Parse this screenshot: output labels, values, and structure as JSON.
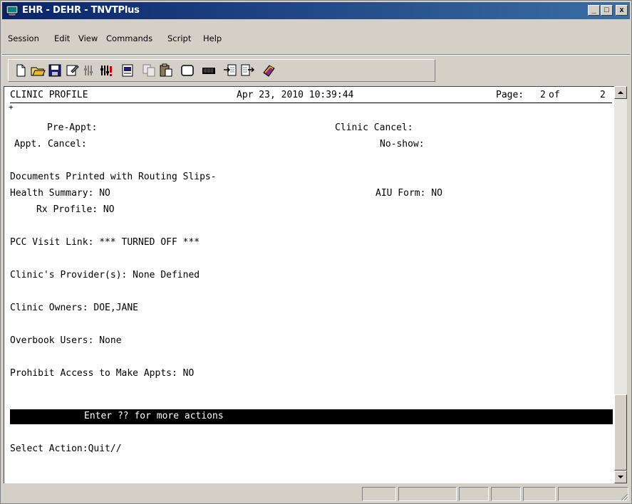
{
  "window": {
    "title": "EHR - DEHR - TNVTPlus",
    "minimize": "_",
    "maximize": "□",
    "close": "x"
  },
  "menu": {
    "items": [
      "Session",
      "Edit",
      "View",
      "Commands",
      "Script",
      "Help"
    ]
  },
  "toolbar": {
    "icons": [
      "new-document-icon",
      "open-folder-icon",
      "save-icon",
      "properties-icon",
      "record-icon",
      "stop-record-icon",
      "print-icon",
      "copy-icon",
      "paste-icon",
      "clear-screen-icon",
      "keyboard-icon",
      "send-icon",
      "receive-icon",
      "help-book-icon"
    ]
  },
  "terminal": {
    "header_title": "CLINIC PROFILE",
    "header_datetime": "Apr 23, 2010 10:39:44",
    "header_page_label": "Page:",
    "header_page_current": "2",
    "header_page_of": "of",
    "header_page_total": "2",
    "plus_marker": "+",
    "pre_appt_label": "Pre-Appt:",
    "clinic_cancel_label": "Clinic Cancel:",
    "appt_cancel_label": "Appt. Cancel:",
    "no_show_label": "No-show:",
    "documents_heading": "Documents Printed with Routing Slips-",
    "health_summary": "Health Summary: NO",
    "aiu_form": "AIU Form: NO",
    "rx_profile": "Rx Profile: NO",
    "pcc_visit_link": "PCC Visit Link: *** TURNED OFF ***",
    "clinic_providers": "Clinic's Provider(s): None Defined",
    "clinic_owners": "Clinic Owners: DOE,JANE",
    "overbook_users": "Overbook Users: None",
    "prohibit_access": "Prohibit Access to Make Appts: NO",
    "action_hint": "Enter ?? for more actions",
    "select_prompt": "Select Action:Quit//"
  }
}
